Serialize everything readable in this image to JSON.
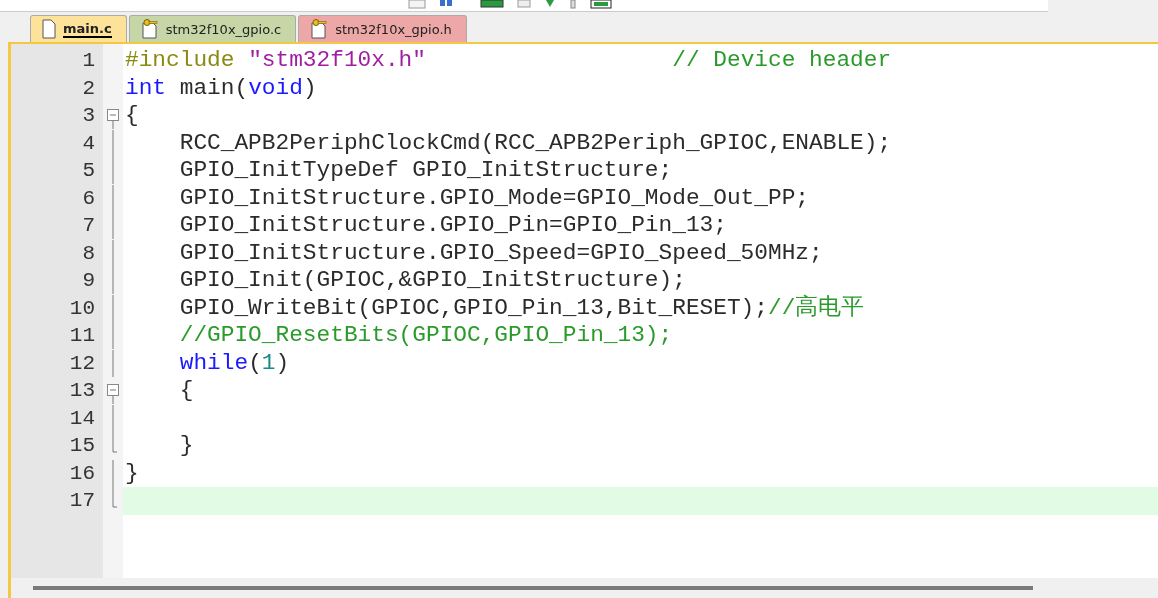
{
  "tabs": [
    {
      "label": "main.c",
      "selected": true,
      "read_only": false,
      "color": "#fde39a"
    },
    {
      "label": "stm32f10x_gpio.c",
      "selected": false,
      "read_only": true,
      "color": "#c6d6a6"
    },
    {
      "label": "stm32f10x_gpio.h",
      "selected": false,
      "read_only": true,
      "color": "#eda7a7"
    }
  ],
  "editor": {
    "lines": [
      {
        "number": "1",
        "kind": "plain",
        "current": false,
        "tokens": [
          {
            "kind": "preprocessor",
            "text": "#include"
          },
          {
            "kind": "string",
            "text": " \"stm32f10x.h\""
          },
          {
            "kind": "comment",
            "text": "                  // Device header"
          }
        ]
      },
      {
        "number": "2",
        "kind": "plain",
        "current": false,
        "tokens": [
          {
            "kind": "keyword",
            "text": "int"
          },
          {
            "kind": "plain",
            "text": " main("
          },
          {
            "kind": "keyword",
            "text": "void"
          },
          {
            "kind": "plain",
            "text": ")"
          }
        ]
      },
      {
        "number": "3",
        "kind": "fold-start",
        "current": false,
        "tokens": [
          {
            "kind": "plain",
            "text": "{"
          }
        ]
      },
      {
        "number": "4",
        "kind": "fold-body",
        "current": false,
        "tokens": [
          {
            "kind": "plain",
            "text": "    RCC_APB2PeriphClockCmd(RCC_APB2Periph_GPIOC,ENABLE);"
          }
        ]
      },
      {
        "number": "5",
        "kind": "fold-body",
        "current": false,
        "tokens": [
          {
            "kind": "plain",
            "text": "    GPIO_InitTypeDef GPIO_InitStructure;"
          }
        ]
      },
      {
        "number": "6",
        "kind": "fold-body",
        "current": false,
        "tokens": [
          {
            "kind": "plain",
            "text": "    GPIO_InitStructure.GPIO_Mode=GPIO_Mode_Out_PP;"
          }
        ]
      },
      {
        "number": "7",
        "kind": "fold-body",
        "current": false,
        "tokens": [
          {
            "kind": "plain",
            "text": "    GPIO_InitStructure.GPIO_Pin=GPIO_Pin_13;"
          }
        ]
      },
      {
        "number": "8",
        "kind": "fold-body",
        "current": false,
        "tokens": [
          {
            "kind": "plain",
            "text": "    GPIO_InitStructure.GPIO_Speed=GPIO_Speed_50MHz;"
          }
        ]
      },
      {
        "number": "9",
        "kind": "fold-body",
        "current": false,
        "tokens": [
          {
            "kind": "plain",
            "text": "    GPIO_Init(GPIOC,&GPIO_InitStructure);"
          }
        ]
      },
      {
        "number": "10",
        "kind": "fold-body",
        "current": false,
        "tokens": [
          {
            "kind": "plain",
            "text": "    GPIO_WriteBit(GPIOC,GPIO_Pin_13,Bit_RESET);"
          },
          {
            "kind": "comment",
            "text": "//高电平"
          }
        ]
      },
      {
        "number": "11",
        "kind": "fold-body",
        "current": false,
        "tokens": [
          {
            "kind": "comment",
            "text": "    //GPIO_ResetBits(GPIOC,GPIO_Pin_13);"
          }
        ]
      },
      {
        "number": "12",
        "kind": "fold-body",
        "current": false,
        "tokens": [
          {
            "kind": "keyword",
            "text": "    while"
          },
          {
            "kind": "plain",
            "text": "("
          },
          {
            "kind": "number",
            "text": "1"
          },
          {
            "kind": "plain",
            "text": ")"
          }
        ]
      },
      {
        "number": "13",
        "kind": "fold-start",
        "current": false,
        "tokens": [
          {
            "kind": "plain",
            "text": "    {"
          }
        ]
      },
      {
        "number": "14",
        "kind": "fold-body",
        "current": false
      },
      {
        "number": "15",
        "kind": "fold-end",
        "current": false,
        "tokens": [
          {
            "kind": "plain",
            "text": "    }"
          }
        ]
      },
      {
        "number": "16",
        "kind": "fold-body",
        "current": false,
        "tokens": [
          {
            "kind": "plain",
            "text": "}"
          }
        ]
      },
      {
        "number": "17",
        "kind": "fold-end",
        "current": true
      }
    ]
  }
}
